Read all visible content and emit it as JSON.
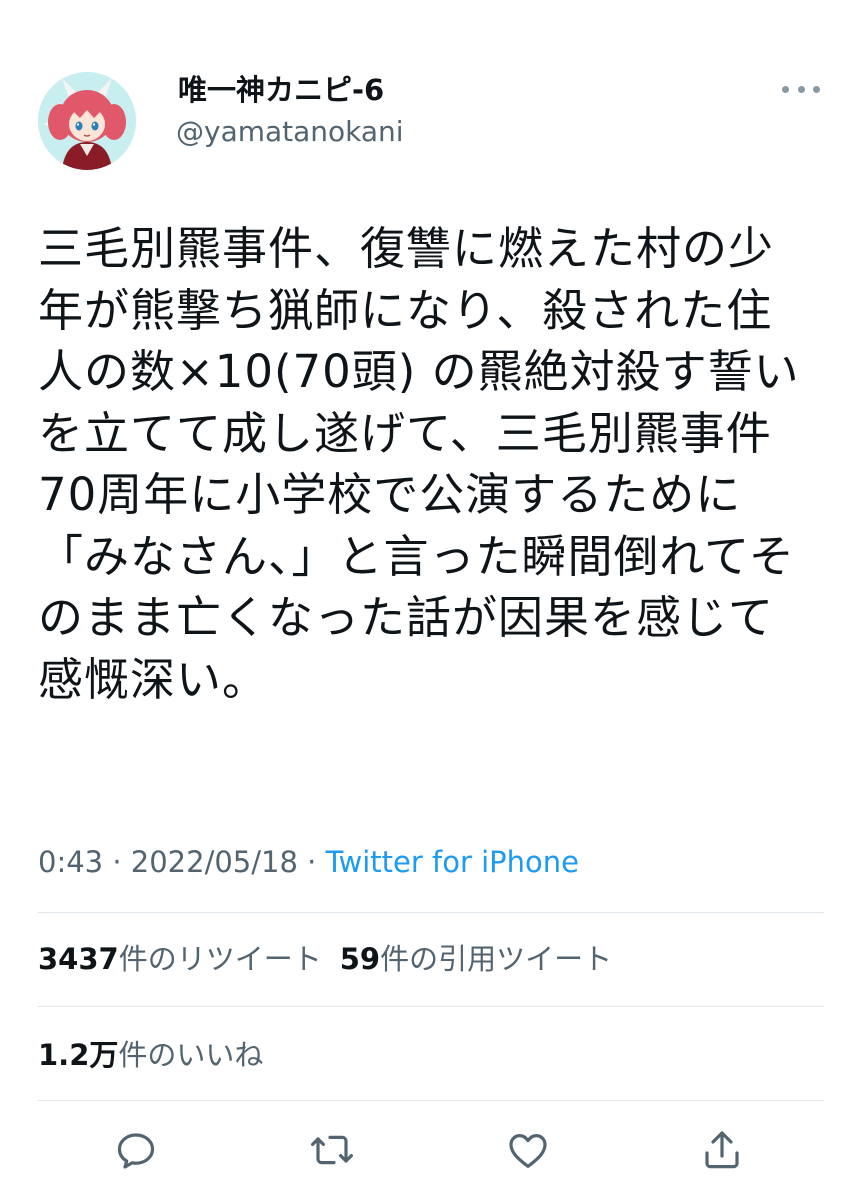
{
  "user": {
    "display_name": "唯一神カニピ-6",
    "handle": "@yamatanokani",
    "avatar_icon": "avatar-image"
  },
  "tweet": {
    "lines": [
      "三毛別羆事件、復讐に燃えた村の少",
      "年が熊撃ち猟師になり、殺された住",
      "人の数×10(70頭) の羆絶対殺す誓い",
      "を立てて成し遂げて、三毛別羆事件",
      "70周年に小学校で公演するために",
      "「みなさん、」と言った瞬間倒れてそ",
      "のまま亡くなった話が因果を感じて",
      "感慨深い。"
    ]
  },
  "meta": {
    "time": "0:43",
    "separator": " · ",
    "date": "2022/05/18",
    "separator2": " · ",
    "source": "Twitter for iPhone"
  },
  "stats": {
    "retweets_count": "3437",
    "retweets_label": "件のリツイート",
    "quotes_count": "59",
    "quotes_label": "件の引用ツイート",
    "likes_count": "1.2万",
    "likes_label": "件のいいね"
  },
  "actions": {
    "reply_icon": "reply-icon",
    "retweet_icon": "retweet-icon",
    "like_icon": "heart-icon",
    "share_icon": "share-icon"
  },
  "colors": {
    "link": "#1d9bf0",
    "secondary_text": "#536471",
    "icon": "#536471",
    "divider": "#e1e8ed"
  }
}
